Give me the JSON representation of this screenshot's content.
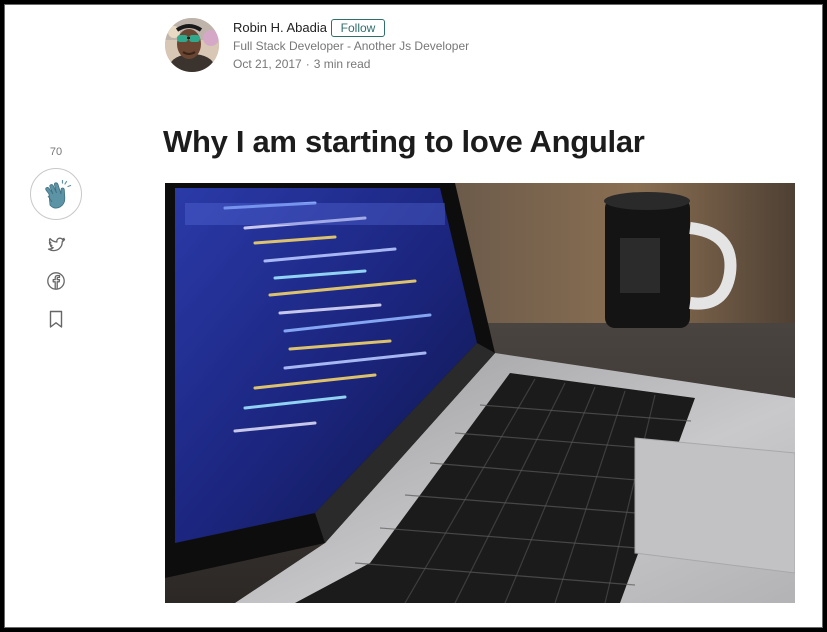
{
  "author": {
    "name": "Robin H. Abadia",
    "follow_label": "Follow",
    "bio": "Full Stack Developer - Another Js Developer",
    "date": "Oct 21, 2017",
    "separator": "·",
    "read_time": "3 min read"
  },
  "article": {
    "title": "Why I am starting to love Angular"
  },
  "share_rail": {
    "clap_count": "70",
    "icons": [
      "clap-icon",
      "twitter-icon",
      "facebook-icon",
      "bookmark-icon"
    ]
  },
  "hero": {
    "image": "laptop-with-code-and-mug-photo"
  },
  "colors": {
    "accent": "#2e6f6a",
    "text": "#1c1c1c",
    "muted": "#777777"
  }
}
